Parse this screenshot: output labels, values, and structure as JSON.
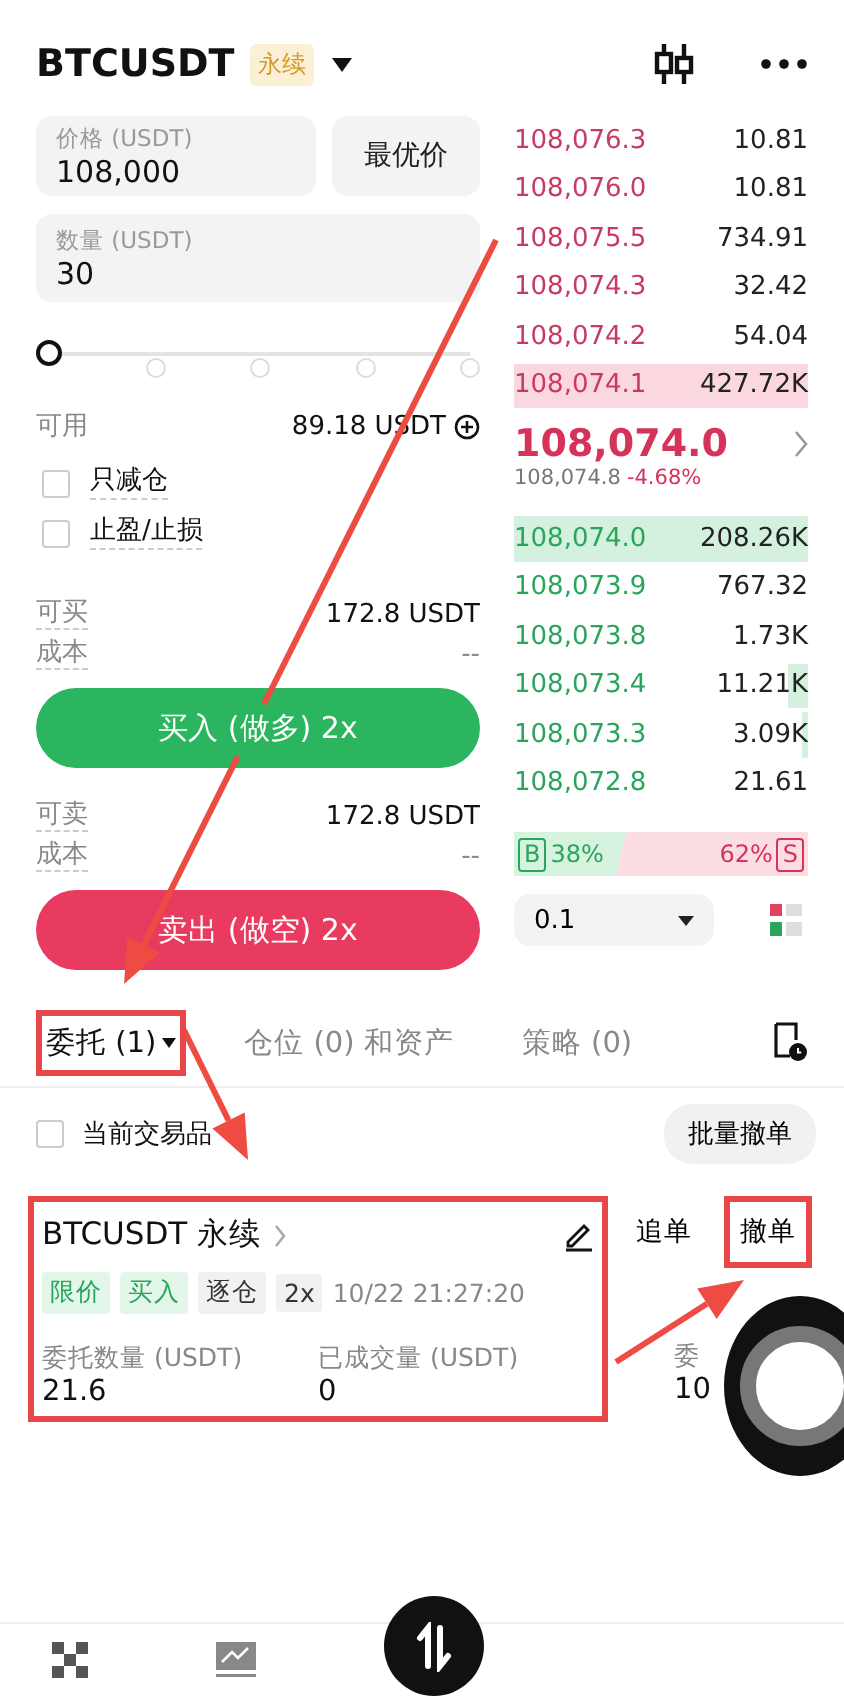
{
  "header": {
    "symbol": "BTCUSDT",
    "badge": "永续"
  },
  "form": {
    "price": {
      "label": "价格 (USDT)",
      "value": "108,000"
    },
    "best_price_button": "最优价",
    "quantity": {
      "label": "数量 (USDT)",
      "value": "30"
    },
    "slider": {
      "level": 0
    },
    "available": {
      "label": "可用",
      "value": "89.18 USDT"
    },
    "options": [
      {
        "label": "只减仓",
        "checked": false
      },
      {
        "label": "止盈/止损",
        "checked": false
      }
    ],
    "sides": [
      {
        "kind": "buy",
        "max_label": "可买",
        "max_value": "172.8 USDT",
        "cost_label": "成本",
        "cost_value": "--",
        "button": "买入 (做多) 2x"
      },
      {
        "kind": "sell",
        "max_label": "可卖",
        "max_value": "172.8 USDT",
        "cost_label": "成本",
        "cost_value": "--",
        "button": "卖出 (做空) 2x"
      }
    ]
  },
  "order_book": {
    "asks": [
      {
        "price": "108,076.3",
        "amount": "10.81"
      },
      {
        "price": "108,076.0",
        "amount": "10.81"
      },
      {
        "price": "108,075.5",
        "amount": "734.91"
      },
      {
        "price": "108,074.3",
        "amount": "32.42"
      },
      {
        "price": "108,074.2",
        "amount": "54.04"
      },
      {
        "price": "108,074.1",
        "amount": "427.72K",
        "level": 1
      }
    ],
    "last_price": "108,074.0",
    "mark_price": "108,074.8",
    "change": "-4.68%",
    "bids": [
      {
        "price": "108,074.0",
        "amount": "208.26K",
        "level": 1
      },
      {
        "price": "108,073.9",
        "amount": "767.32"
      },
      {
        "price": "108,073.8",
        "amount": "1.73K"
      },
      {
        "price": "108,073.4",
        "amount": "11.21K",
        "level": 0.07
      },
      {
        "price": "108,073.3",
        "amount": "3.09K",
        "level": 0.02
      },
      {
        "price": "108,072.8",
        "amount": "21.61"
      }
    ],
    "buy_ratio": {
      "label": "B",
      "value": "38%",
      "level": 0.38
    },
    "sell_ratio": {
      "label": "S",
      "value": "62%"
    },
    "precision": "0.1"
  },
  "orders_panel": {
    "tabs": [
      {
        "label": "委托 (1)",
        "selected": true,
        "highlighted": true
      },
      {
        "label": "仓位 (0) 和资产",
        "selected": false,
        "highlighted": false
      },
      {
        "label": "策略 (0)",
        "selected": false,
        "highlighted": false
      }
    ],
    "filter": {
      "label": "当前交易品",
      "checked": false
    },
    "batch_cancel_button": "批量撤单",
    "orders": [
      {
        "title": "BTCUSDT 永续",
        "highlighted": true,
        "tags": [
          {
            "label": "限价",
            "kind": "accent"
          },
          {
            "label": "买入",
            "kind": "accent"
          },
          {
            "label": "逐仓",
            "kind": "plain"
          },
          {
            "label": "2x",
            "kind": "plain"
          }
        ],
        "time": "10/22 21:27:20",
        "fields": [
          {
            "label": "委托数量 (USDT)",
            "value": "21.6"
          },
          {
            "label": "已成交量 (USDT)",
            "value": "0"
          },
          {
            "label": "委",
            "value": "10"
          }
        ],
        "actions": [
          {
            "label": "追单",
            "highlighted": false
          },
          {
            "label": "撤单",
            "highlighted": true
          }
        ]
      }
    ]
  }
}
